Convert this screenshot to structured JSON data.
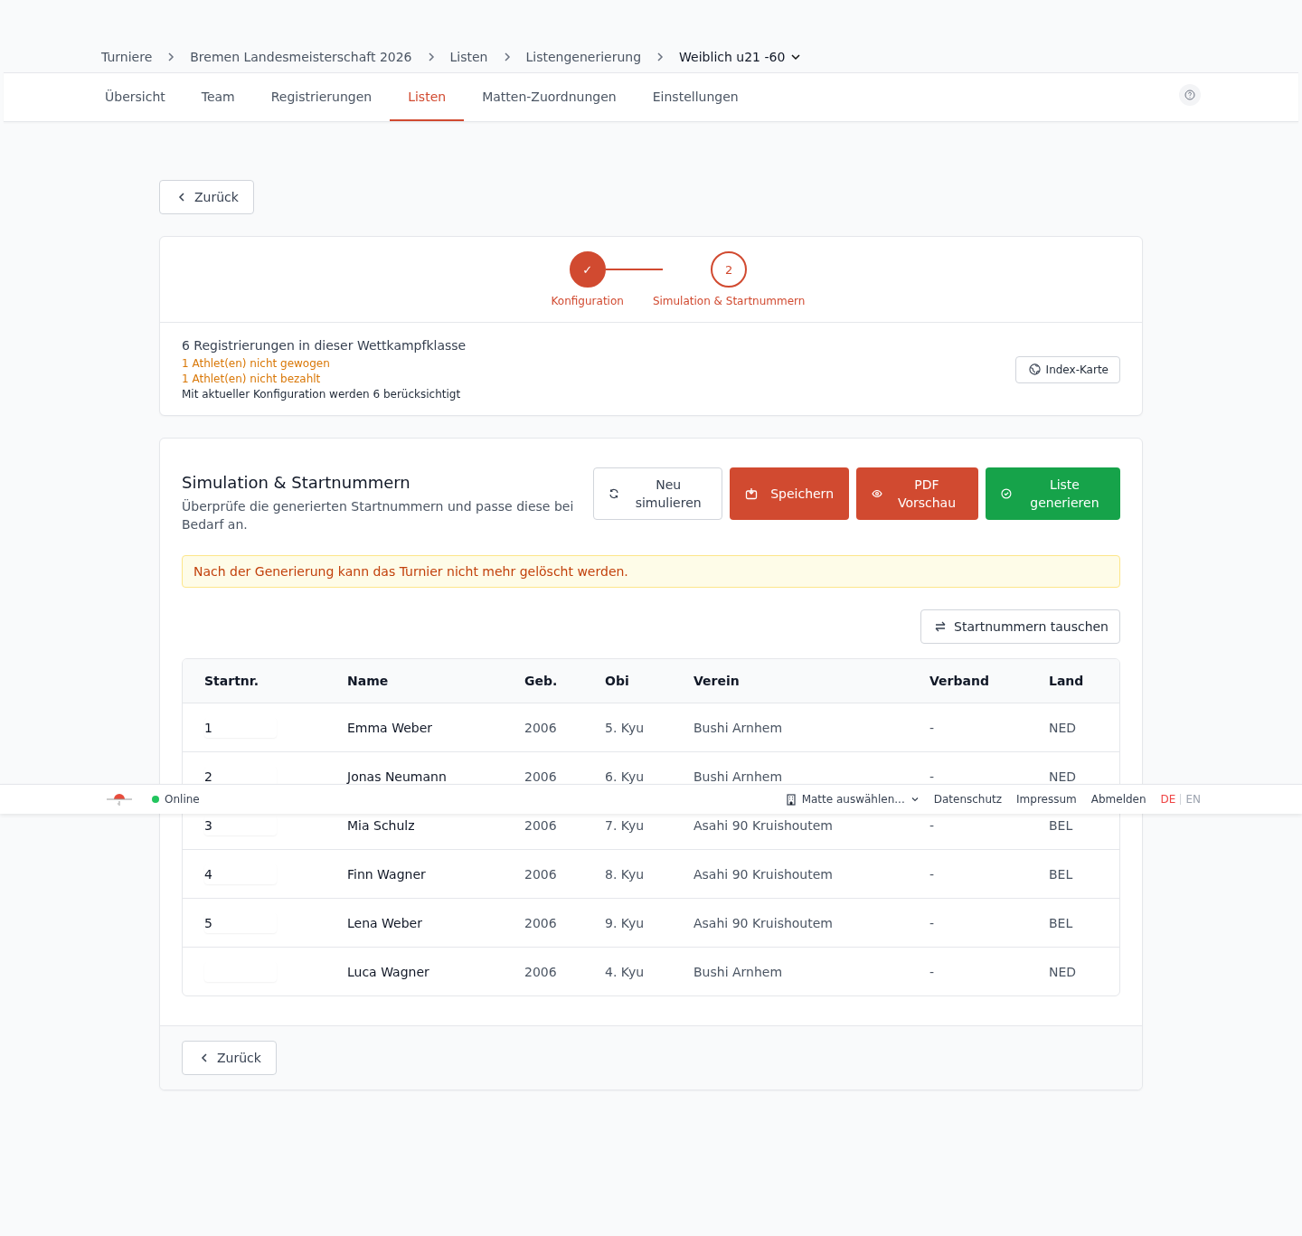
{
  "breadcrumb": [
    {
      "label": "Turniere",
      "current": false
    },
    {
      "label": "Bremen Landesmeisterschaft 2026",
      "current": false
    },
    {
      "label": "Listen",
      "current": false
    },
    {
      "label": "Listengenerierung",
      "current": false
    },
    {
      "label": "Weiblich u21 -60",
      "current": true
    }
  ],
  "tabs": [
    {
      "label": "Übersicht",
      "selected": false
    },
    {
      "label": "Team",
      "selected": false
    },
    {
      "label": "Registrierungen",
      "selected": false
    },
    {
      "label": "Listen",
      "selected": true
    },
    {
      "label": "Matten-Zuordnungen",
      "selected": false
    },
    {
      "label": "Einstellungen",
      "selected": false
    }
  ],
  "back_button": "Zurück",
  "stepper": [
    {
      "marker": "✓",
      "label": "Konfiguration",
      "done": true
    },
    {
      "marker": "2",
      "label": "Simulation & Startnummern",
      "done": false
    }
  ],
  "summary": {
    "title": "6 Registrierungen in dieser Wettkampfklasse",
    "warnings": [
      "1 Athlet(en) nicht gewogen",
      "1 Athlet(en) nicht bezahlt"
    ],
    "note": "Mit aktueller Konfiguration werden 6 berücksichtigt",
    "index_button": "Index-Karte"
  },
  "simulation": {
    "title": "Simulation & Startnummern",
    "description": "Überprüfe die generierten Startnummern und passe diese bei Bedarf an.",
    "actions": [
      {
        "label": "Neu simulieren",
        "kind": "secondary"
      },
      {
        "label": "Speichern",
        "kind": "primary"
      },
      {
        "label": "PDF Vorschau",
        "kind": "primary"
      },
      {
        "label": "Liste generieren",
        "kind": "success"
      }
    ],
    "alert": "Nach der Generierung kann das Turnier nicht mehr gelöscht werden.",
    "swap_button": "Startnummern tauschen",
    "table": {
      "columns": [
        "Startnr.",
        "Name",
        "Geb.",
        "Obi",
        "Verein",
        "Verband",
        "Land"
      ],
      "rows": [
        {
          "startnr": "1",
          "name": "Emma Weber",
          "geb": "2006",
          "obi": "5. Kyu",
          "verein": "Bushi Arnhem",
          "verband": "-",
          "land": "NED"
        },
        {
          "startnr": "2",
          "name": "Jonas Neumann",
          "geb": "2006",
          "obi": "6. Kyu",
          "verein": "Bushi Arnhem",
          "verband": "-",
          "land": "NED"
        },
        {
          "startnr": "3",
          "name": "Mia Schulz",
          "geb": "2006",
          "obi": "7. Kyu",
          "verein": "Asahi 90 Kruishoutem",
          "verband": "-",
          "land": "BEL"
        },
        {
          "startnr": "4",
          "name": "Finn Wagner",
          "geb": "2006",
          "obi": "8. Kyu",
          "verein": "Asahi 90 Kruishoutem",
          "verband": "-",
          "land": "BEL"
        },
        {
          "startnr": "5",
          "name": "Lena Weber",
          "geb": "2006",
          "obi": "9. Kyu",
          "verein": "Asahi 90 Kruishoutem",
          "verband": "-",
          "land": "BEL"
        },
        {
          "name": "Luca Wagner",
          "geb": "2006",
          "obi": "4. Kyu",
          "verein": "Bushi Arnhem",
          "verband": "-",
          "land": "NED"
        }
      ]
    },
    "back_button": "Zurück"
  },
  "footer": {
    "status": "Online",
    "online": true,
    "mat_select": "Matte auswählen...",
    "links": [
      "Datenschutz",
      "Impressum",
      "Abmelden"
    ],
    "languages": [
      {
        "label": "DE",
        "selected": true
      },
      {
        "label": "EN",
        "selected": false
      }
    ]
  }
}
